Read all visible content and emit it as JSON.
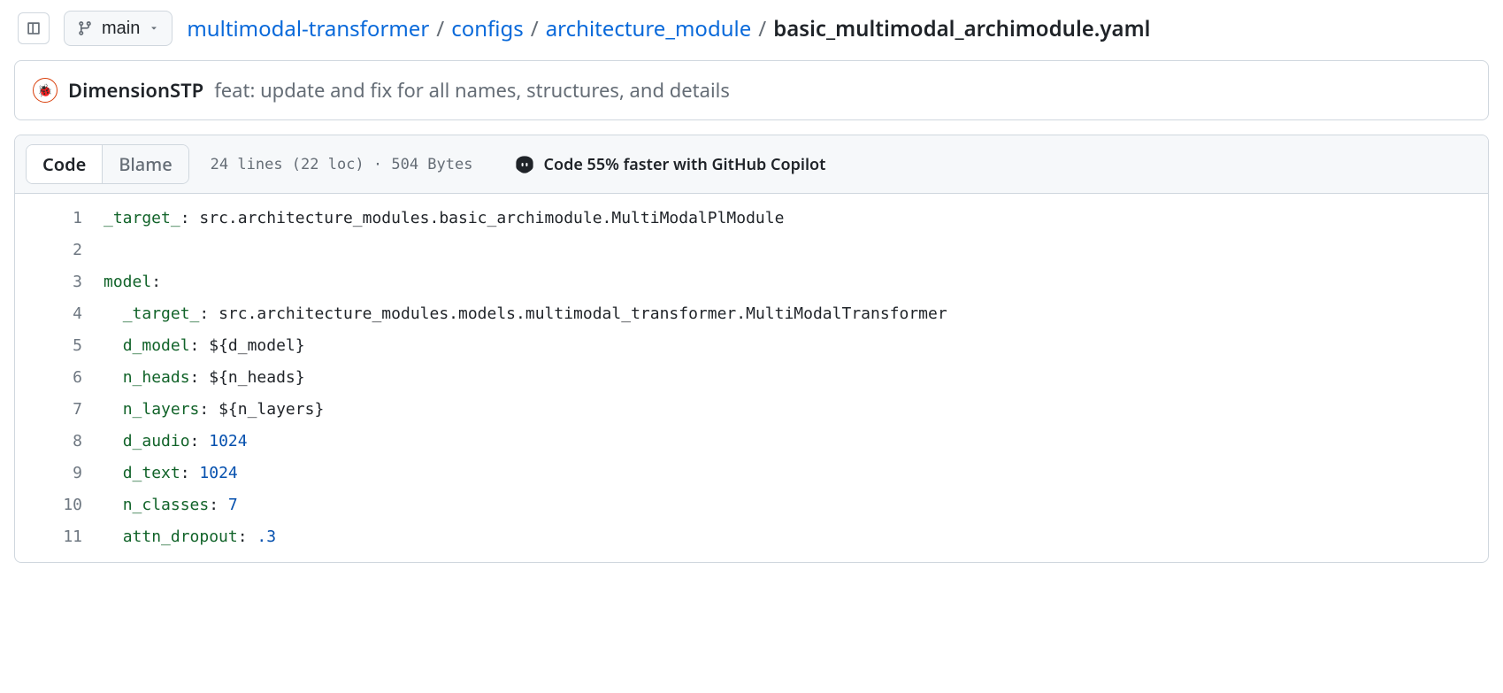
{
  "header": {
    "branch_label": "main",
    "breadcrumb": {
      "parts": [
        "multimodal-transformer",
        "configs",
        "architecture_module"
      ],
      "current": "basic_multimodal_archimodule.yaml",
      "separator": "/"
    }
  },
  "commit": {
    "author": "DimensionSTP",
    "message": "feat: update and fix for all names, structures, and details"
  },
  "toolbar": {
    "tab_code": "Code",
    "tab_blame": "Blame",
    "stats": "24 lines (22 loc) · 504 Bytes",
    "copilot_promo": "Code 55% faster with GitHub Copilot"
  },
  "code": {
    "line_numbers": [
      "1",
      "2",
      "3",
      "4",
      "5",
      "6",
      "7",
      "8",
      "9",
      "10",
      "11"
    ],
    "lines": [
      {
        "indent": 0,
        "key": "_target_",
        "value": "src.architecture_modules.basic_archimodule.MultiModalPlModule",
        "vtype": "str"
      },
      {
        "blank": true
      },
      {
        "indent": 0,
        "key": "model",
        "value": "",
        "vtype": "none"
      },
      {
        "indent": 1,
        "key": "_target_",
        "value": "src.architecture_modules.models.multimodal_transformer.MultiModalTransformer",
        "vtype": "str"
      },
      {
        "indent": 1,
        "key": "d_model",
        "value": "${d_model}",
        "vtype": "str"
      },
      {
        "indent": 1,
        "key": "n_heads",
        "value": "${n_heads}",
        "vtype": "str"
      },
      {
        "indent": 1,
        "key": "n_layers",
        "value": "${n_layers}",
        "vtype": "str"
      },
      {
        "indent": 1,
        "key": "d_audio",
        "value": "1024",
        "vtype": "num"
      },
      {
        "indent": 1,
        "key": "d_text",
        "value": "1024",
        "vtype": "num"
      },
      {
        "indent": 1,
        "key": "n_classes",
        "value": "7",
        "vtype": "num"
      },
      {
        "indent": 1,
        "key": "attn_dropout",
        "value": ".3",
        "vtype": "num"
      }
    ]
  }
}
